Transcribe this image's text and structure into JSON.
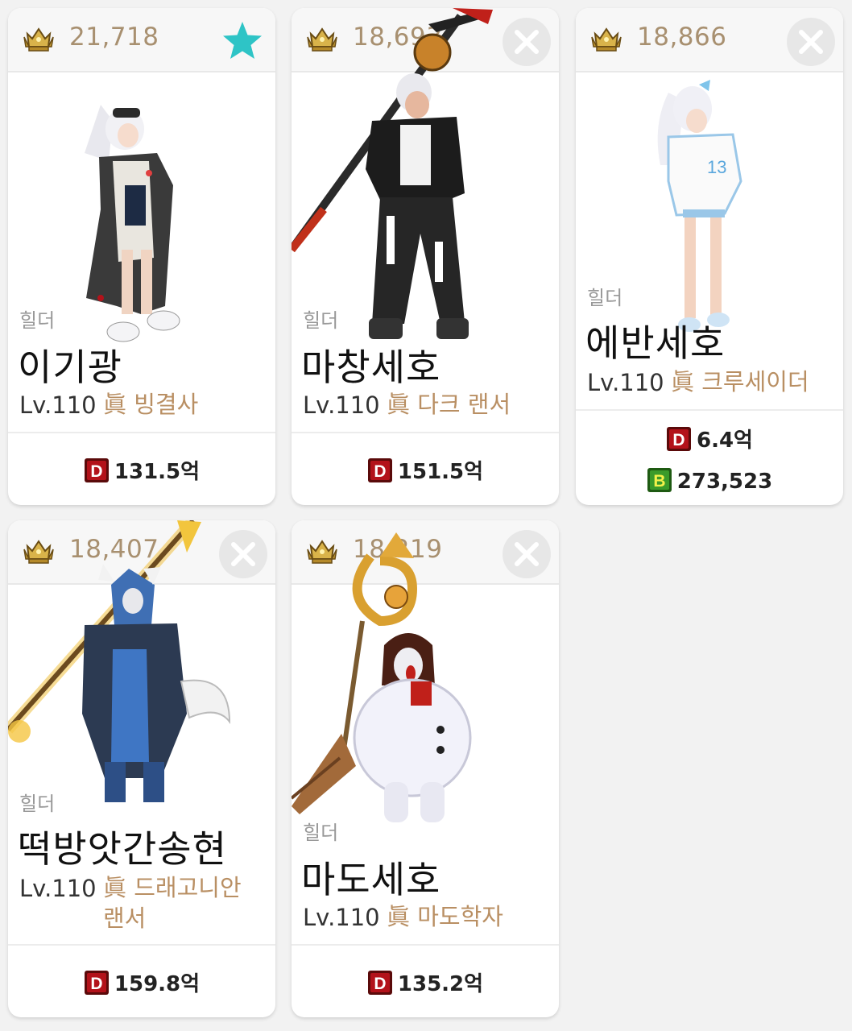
{
  "cards": [
    {
      "score": "21,718",
      "job_type": "힐더",
      "name": "이기광",
      "level": "Lv.110",
      "class_line1": "眞 빙결사",
      "class_line2": "",
      "stats": [
        {
          "icon": "d-icon",
          "value": "131.5억"
        }
      ],
      "action": "star-icon"
    },
    {
      "score": "18,693",
      "job_type": "힐더",
      "name": "마창세호",
      "level": "Lv.110",
      "class_line1": "眞 다크 랜서",
      "class_line2": "",
      "stats": [
        {
          "icon": "d-icon",
          "value": "151.5억"
        }
      ],
      "action": "close-icon"
    },
    {
      "score": "18,866",
      "job_type": "힐더",
      "name": "에반세호",
      "level": "Lv.110",
      "class_line1": "眞 크루세이더",
      "class_line2": "",
      "stats": [
        {
          "icon": "d-icon",
          "value": "6.4억"
        },
        {
          "icon": "b-icon",
          "value": "273,523"
        }
      ],
      "action": "close-icon"
    },
    {
      "score": "18,407",
      "job_type": "힐더",
      "name": "떡방앗간송현",
      "level": "Lv.110",
      "class_line1": "眞 드래고니안",
      "class_line2": "랜서",
      "stats": [
        {
          "icon": "d-icon",
          "value": "159.8억"
        }
      ],
      "action": "close-icon"
    },
    {
      "score": "18,219",
      "job_type": "힐더",
      "name": "마도세호",
      "level": "Lv.110",
      "class_line1": "眞 마도학자",
      "class_line2": "",
      "stats": [
        {
          "icon": "d-icon",
          "value": "135.2억"
        }
      ],
      "action": "close-icon"
    }
  ],
  "colors": {
    "score": "#a89070",
    "class": "#b98f63",
    "star": "#2ec4c6",
    "d_icon": "#b3121a",
    "b_icon": "#3a9b2a"
  }
}
